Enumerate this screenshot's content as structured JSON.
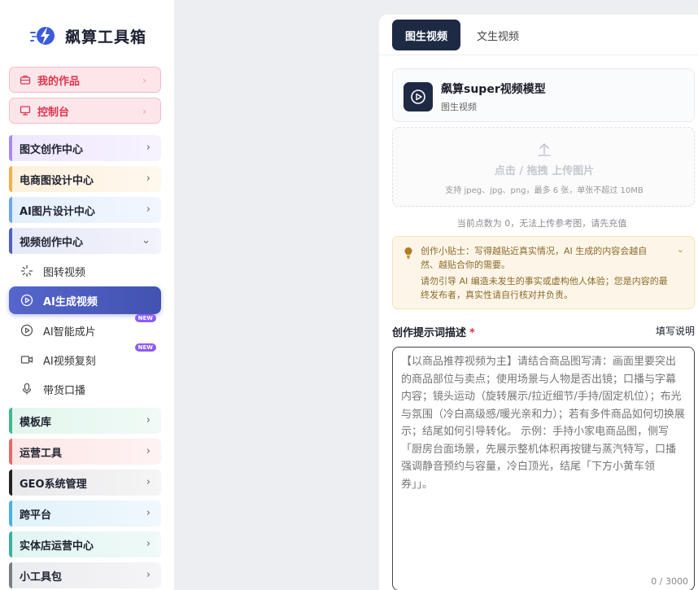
{
  "app": {
    "name": "飙算工具箱"
  },
  "colors": {
    "accent": "#1e2a44",
    "active_item": "#4f5fc2",
    "pink": "#e0344f",
    "tip_bg": "#fdf6e8"
  },
  "sidebar": {
    "quick": [
      {
        "label": "我的作品",
        "icon": "briefcase-icon"
      },
      {
        "label": "控制台",
        "icon": "monitor-icon"
      }
    ],
    "categories_top": [
      {
        "label": "图文创作中心",
        "bar": "#a98bf0",
        "bg": "linear-gradient(90deg,#efe7fd,#f7f3fe)"
      },
      {
        "label": "电商图设计中心",
        "bar": "#f0b04a",
        "bg": "linear-gradient(90deg,#fdf1dc,#fef8ee)"
      },
      {
        "label": "AI图片设计中心",
        "bar": "#6ea6e8",
        "bg": "linear-gradient(90deg,#e3effc,#f2f7fe)"
      },
      {
        "label": "视频创作中心",
        "bar": "#4f5fc2",
        "bg": "linear-gradient(90deg,#e5e8f7,#f2f3fb)"
      }
    ],
    "video_items": [
      {
        "label": "图转视频",
        "icon": "sparkle-icon",
        "badge": ""
      },
      {
        "label": "AI生成视频",
        "icon": "play-circle-icon",
        "badge": ""
      },
      {
        "label": "AI智能成片",
        "icon": "play-circle-icon",
        "badge": "NEW"
      },
      {
        "label": "AI视频复刻",
        "icon": "video-camera-icon",
        "badge": "NEW"
      },
      {
        "label": "带货口播",
        "icon": "microphone-icon",
        "badge": ""
      }
    ],
    "categories_bottom": [
      {
        "label": "模板库",
        "bar": "#3fb98a",
        "bg": "linear-gradient(90deg,#e2f6ee,#f1faf6)"
      },
      {
        "label": "运营工具",
        "bar": "#e26a6a",
        "bg": "linear-gradient(90deg,#fde6e6,#fef3f3)"
      },
      {
        "label": "GEO系统管理",
        "bar": "#222222",
        "bg": "linear-gradient(90deg,#e9e9eb,#f5f5f6)"
      },
      {
        "label": "跨平台",
        "bar": "#4ab0e0",
        "bg": "linear-gradient(90deg,#e1f2fb,#f0f8fd)"
      },
      {
        "label": "实体店运营中心",
        "bar": "#3bb0a0",
        "bg": "linear-gradient(90deg,#e0f5f2,#f0faf8)"
      },
      {
        "label": "小工具包",
        "bar": "#7a7d86",
        "bg": "linear-gradient(90deg,#ebecef,#f5f5f7)"
      }
    ]
  },
  "main": {
    "tabs": [
      {
        "label": "图生视频",
        "active": true
      },
      {
        "label": "文生视频",
        "active": false
      }
    ],
    "model": {
      "title": "飙算super视频模型",
      "subtitle": "图生视频",
      "icon": "play-circle-icon"
    },
    "upload": {
      "title": "点击 / 拖拽 上传图片",
      "hint": "支持 jpeg、jpg、png，最多 6 张，单张不超过 10MB",
      "icon": "upload-icon"
    },
    "points_notice": "当前点数为 0，无法上传参考图，请先充值",
    "tip": {
      "line1": "创作小贴士：写得越贴近真实情况，AI 生成的内容会越自然、越贴合你的需要。",
      "line2": "请勿引导 AI 编造未发生的事实或虚构他人体验；您是内容的最终发布者，真实性请自行核对并负责。",
      "icon": "lightbulb-icon"
    },
    "prompt": {
      "label": "创作提示词描述",
      "required_mark": "*",
      "help": "填写说明",
      "placeholder": "【以商品推荐视频为主】请结合商品图写清：画面里要突出的商品部位与卖点；使用场景与人物是否出镜；口播与字幕内容；镜头运动（旋转展示/拉近细节/手持/固定机位）；布光与氛围（冷白高级感/暖光亲和力）；若有多件商品如何切换展示；结尾如何引导转化。 示例：手持小家电商品图，侧写「厨房台面场景，先展示整机体积再按键与蒸汽特写，口播强调静音预约与容量，冷白顶光，结尾「下方小黄车领券」」。",
      "counter": "0 / 3000"
    }
  }
}
